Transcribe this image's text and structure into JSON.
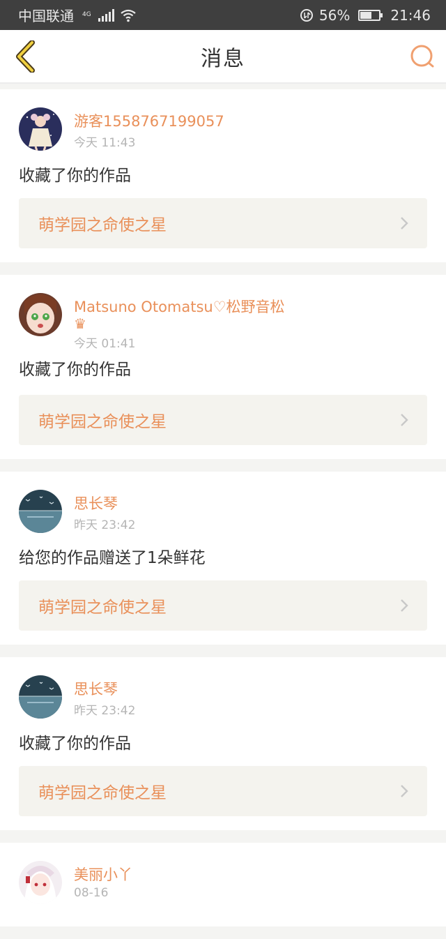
{
  "status_bar": {
    "carrier": "中国联通",
    "network": "4G",
    "battery_percent": "56%",
    "battery_level": 0.56,
    "time": "21:46"
  },
  "header": {
    "title": "消息",
    "back_icon": "chevron-left-icon",
    "search_icon": "search-icon"
  },
  "colors": {
    "accent": "#e9905a",
    "text": "#333333",
    "muted": "#b5b5b5",
    "box_bg": "#f4f3ee"
  },
  "messages": [
    {
      "user": "游客1558767199057",
      "time": "今天 11:43",
      "action": "收藏了你的作品",
      "work": "萌学园之命使之星",
      "has_crown": false
    },
    {
      "user": "Matsuno Otomatsu♡松野音松",
      "crown": "♛",
      "time": "今天 01:41",
      "action": "收藏了你的作品",
      "work": "萌学园之命使之星",
      "has_crown": true
    },
    {
      "user": "思长琴",
      "time": "昨天 23:42",
      "action": "给您的作品赠送了1朵鲜花",
      "work": "萌学园之命使之星",
      "has_crown": false
    },
    {
      "user": "思长琴",
      "time": "昨天 23:42",
      "action": "收藏了你的作品",
      "work": "萌学园之命使之星",
      "has_crown": false
    },
    {
      "user": "美丽小丫",
      "time": "08-16",
      "action": "",
      "work": "",
      "has_crown": false
    }
  ]
}
